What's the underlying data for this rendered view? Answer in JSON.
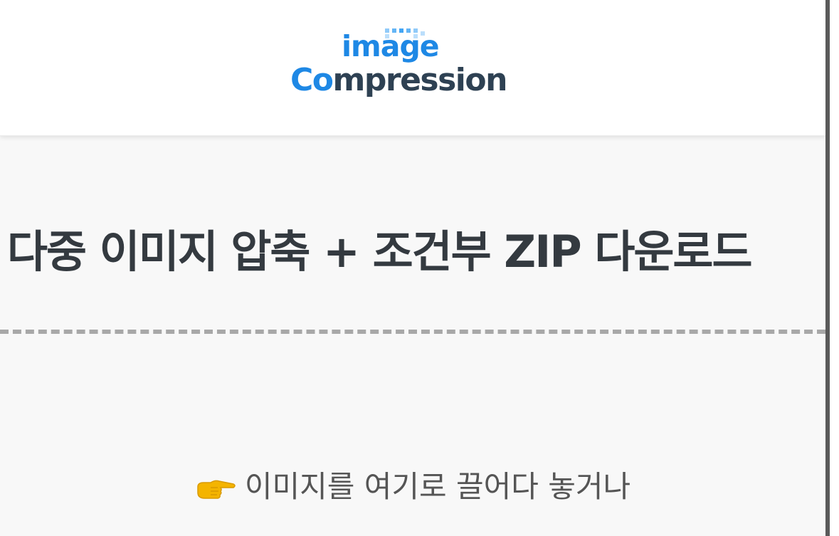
{
  "header": {
    "logo": {
      "line1": "image",
      "line2": "Compression",
      "colors": {
        "blue": "#1e88e5",
        "dark": "#2e4153"
      }
    }
  },
  "main": {
    "title": "다중 이미지 압축 + 조건부 ZIP 다운로드",
    "dropzone": {
      "icon": "pointing-hand-icon",
      "text": "이미지를 여기로 끌어다 놓거나"
    }
  },
  "colors": {
    "title": "#343a40",
    "dashed_border": "#a8a8a8",
    "background": "#f8f8f8"
  }
}
